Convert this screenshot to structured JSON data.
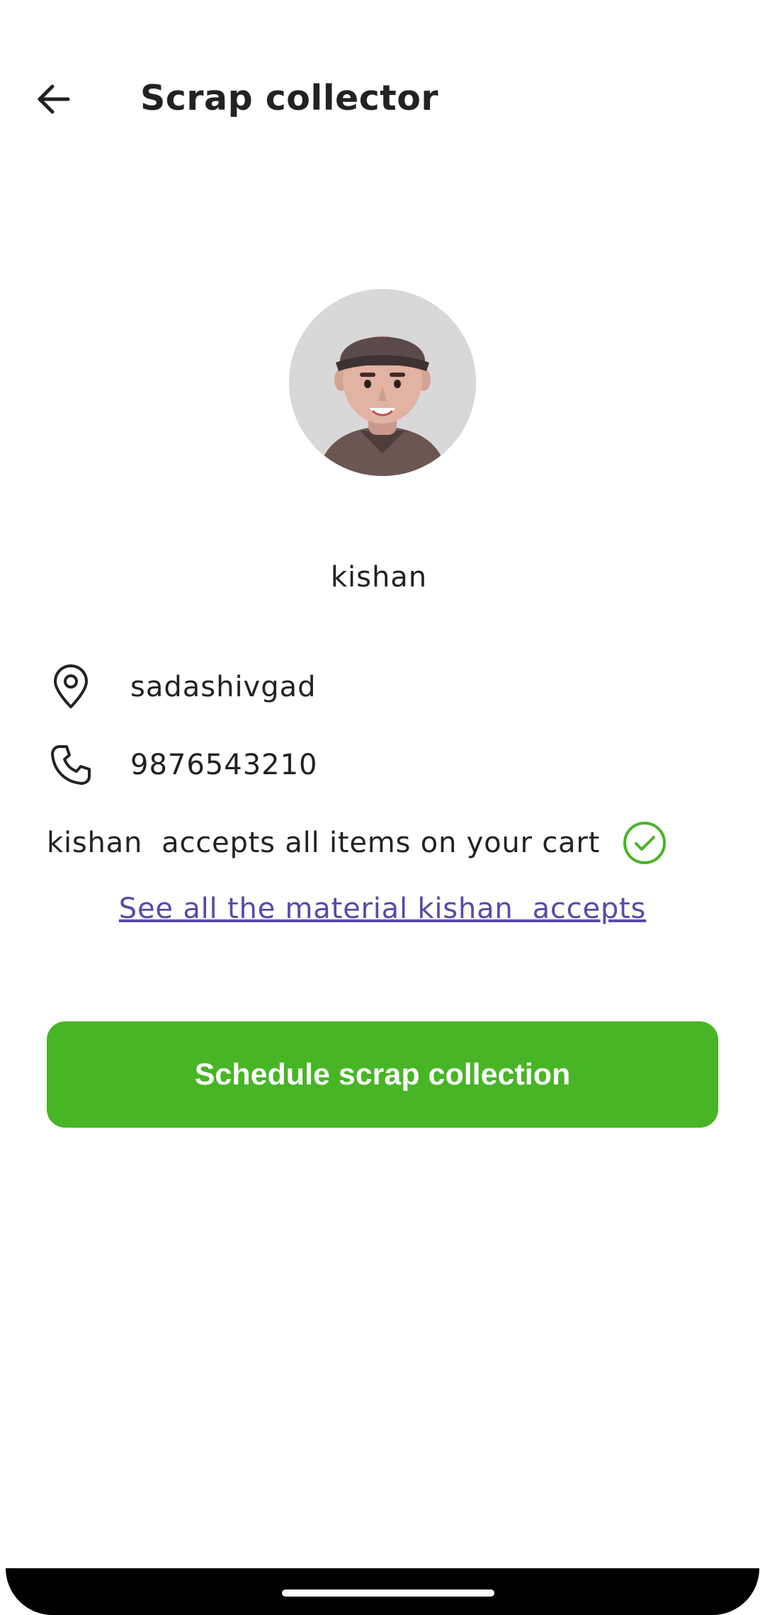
{
  "header": {
    "title": "Scrap collector",
    "back_icon": "arrow-left-icon"
  },
  "collector": {
    "name": "kishan",
    "location": "sadashivgad",
    "phone": "9876543210",
    "location_icon": "location-pin-icon",
    "phone_icon": "phone-icon"
  },
  "acceptance": {
    "message": "kishan  accepts all items on your cart",
    "status_icon": "check-circle-icon",
    "link_text": "See all the material kishan  accepts"
  },
  "actions": {
    "schedule_label": "Schedule scrap collection"
  },
  "colors": {
    "primary_green": "#47b525",
    "link_purple": "#5b48a8",
    "text_dark": "#222222"
  }
}
